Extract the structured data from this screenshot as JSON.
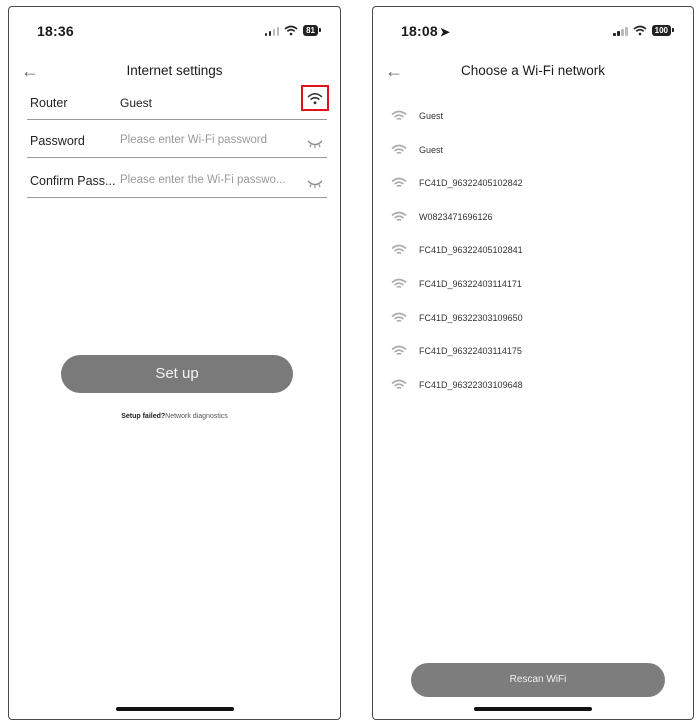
{
  "left_screen": {
    "status": {
      "time": "18:36",
      "battery": "81"
    },
    "nav": {
      "back": "←",
      "title": "Internet settings"
    },
    "router": {
      "label": "Router",
      "value": "Guest"
    },
    "password": {
      "label": "Password",
      "placeholder": "Please enter Wi-Fi password"
    },
    "confirm": {
      "label": "Confirm Pass...",
      "placeholder": "Please enter the Wi-Fi passwo..."
    },
    "setup_button": "Set up",
    "hint": {
      "failed": "Setup failed?",
      "link": "Network diagnostics"
    },
    "highlight_color": "#e0121b"
  },
  "right_screen": {
    "status": {
      "time": "18:08",
      "battery": "100"
    },
    "nav": {
      "back": "←",
      "title": "Choose a Wi-Fi network"
    },
    "networks": [
      "Guest",
      "Guest",
      "FC41D_96322405102842",
      "W0823471696126",
      "FC41D_96322405102841",
      "FC41D_96322403114171",
      "FC41D_96322303109650",
      "FC41D_96322403114175",
      "FC41D_96322303109648"
    ],
    "rescan_button": "Rescan WiFi"
  }
}
